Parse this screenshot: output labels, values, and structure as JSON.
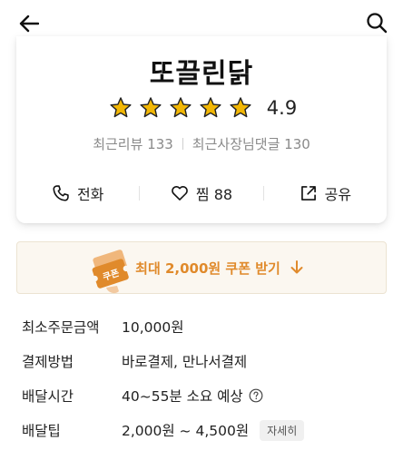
{
  "header": {
    "back_icon": "arrow-left-icon",
    "search_icon": "search-icon"
  },
  "store": {
    "name": "또끌린닭",
    "rating": "4.9",
    "rating_stars": 5,
    "star_color": "#f2b705",
    "recent_reviews": "최근리뷰 133",
    "owner_replies": "최근사장님댓글 130"
  },
  "actions": {
    "call_label": "전화",
    "call_icon": "phone-icon",
    "favorite_label": "찜 88",
    "favorite_icon": "heart-icon",
    "share_label": "공유",
    "share_icon": "share-icon"
  },
  "coupon": {
    "label": "최대 2,000원 쿠폰 받기",
    "ticket_text": "쿠폰",
    "accent_color": "#e08a2b"
  },
  "info": [
    {
      "label": "최소주문금액",
      "value": "10,000원"
    },
    {
      "label": "결제방법",
      "value": "바로결제, 만나서결제"
    },
    {
      "label": "배달시간",
      "value": "40~55분 소요 예상"
    },
    {
      "label": "배달팁",
      "value": "2,000원 ~ 4,500원",
      "detail_label": "자세히"
    }
  ]
}
